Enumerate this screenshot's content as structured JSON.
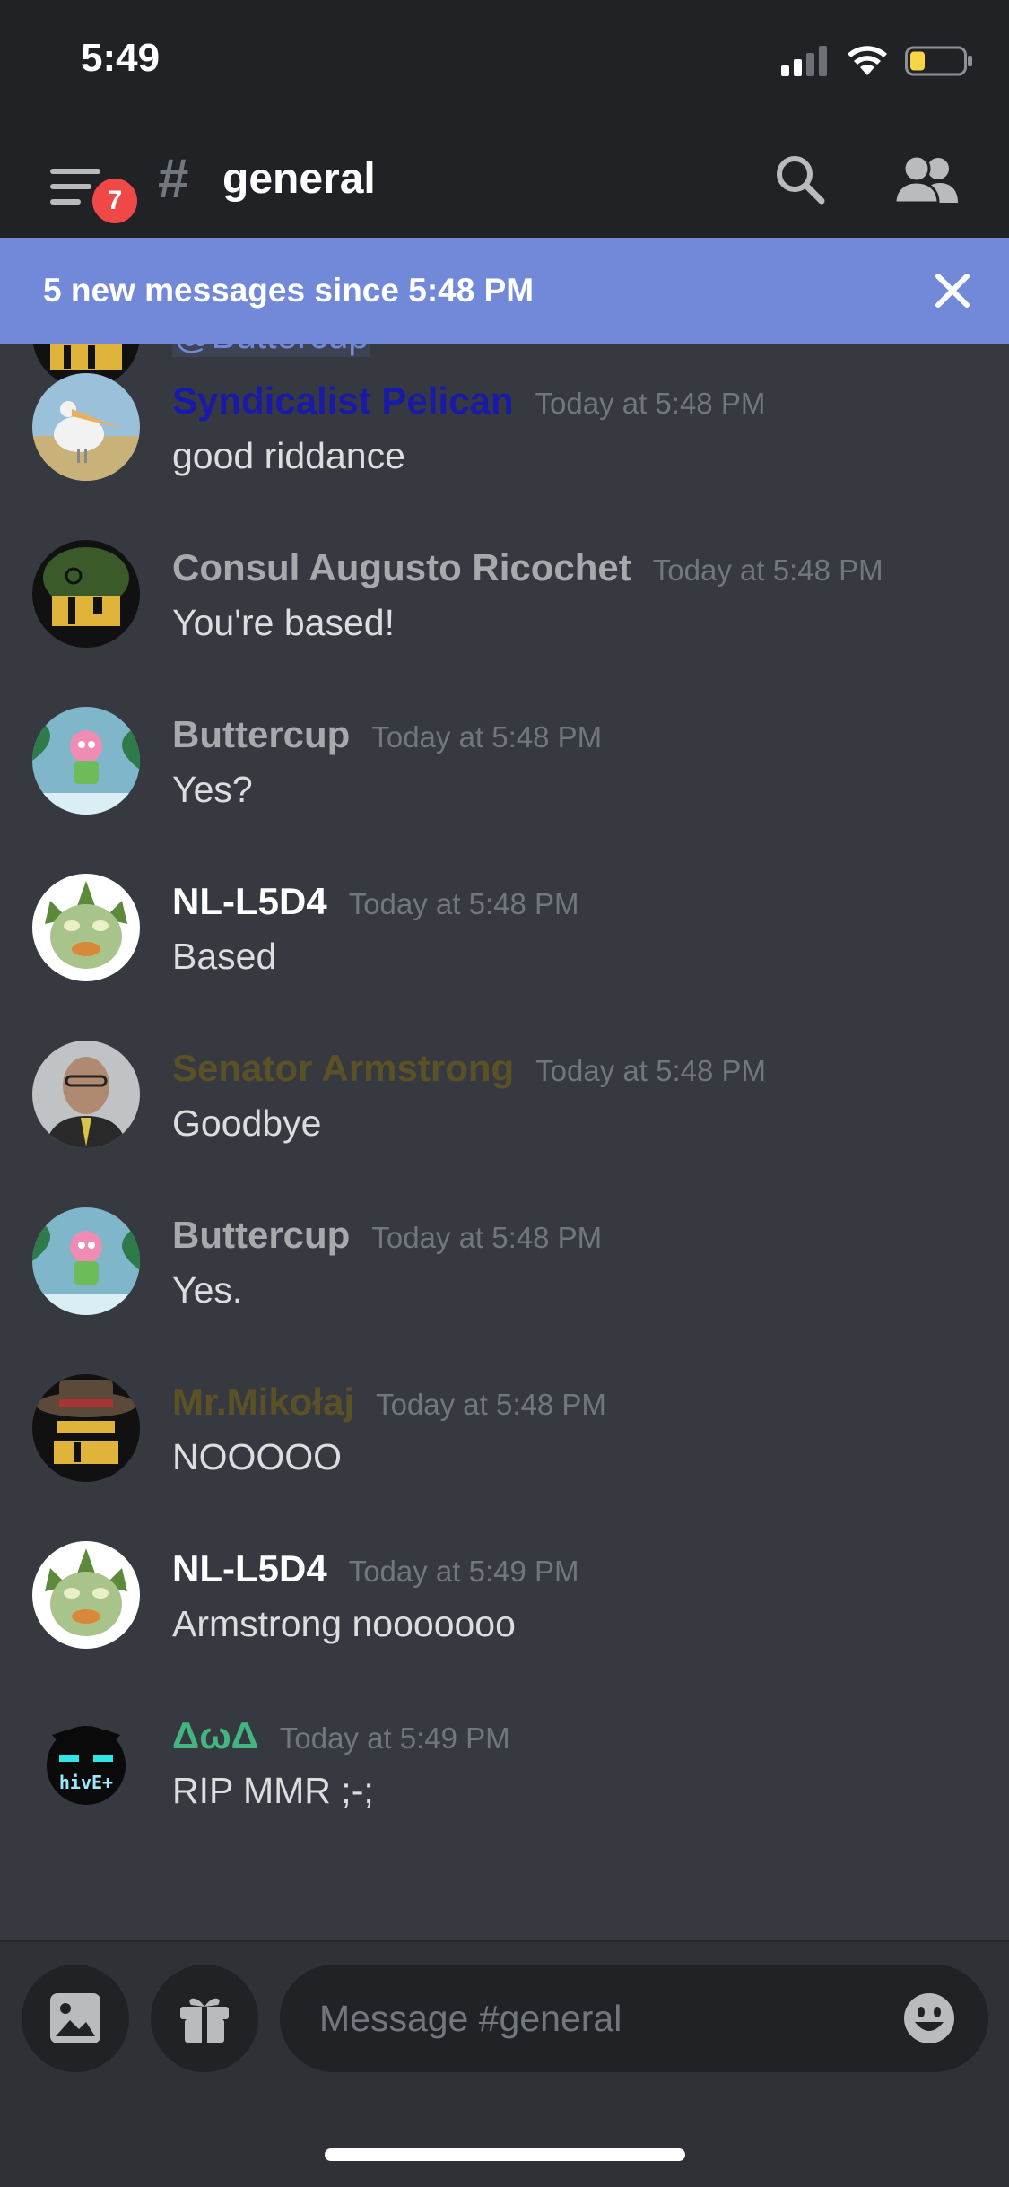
{
  "status_bar": {
    "time": "5:49"
  },
  "header": {
    "unread_badge": "7",
    "hash_symbol": "#",
    "channel_name": "general"
  },
  "banner": {
    "text": "5 new messages since 5:48 PM"
  },
  "partial_message": {
    "content": "@Buttercup"
  },
  "messages": [
    {
      "author": "Syndicalist Pelican",
      "author_color": "#1a1aa8",
      "timestamp": "Today at 5:48 PM",
      "content": "good riddance",
      "avatar": "pelican-avatar"
    },
    {
      "author": "Consul Augusto Ricochet",
      "author_color": "#a7a9ac",
      "timestamp": "Today at 5:48 PM",
      "content": "You're based!",
      "avatar": "helmet-cat-avatar"
    },
    {
      "author": "Buttercup",
      "author_color": "#a7a9ac",
      "timestamp": "Today at 5:48 PM",
      "content": "Yes?",
      "avatar": "pink-hedgehog-avatar"
    },
    {
      "author": "NL-L5D4",
      "author_color": "#ffffff",
      "timestamp": "Today at 5:48 PM",
      "content": "Based",
      "avatar": "green-creature-avatar"
    },
    {
      "author": "Senator Armstrong",
      "author_color": "#5b5126",
      "timestamp": "Today at 5:48 PM",
      "content": "Goodbye",
      "avatar": "senator-avatar"
    },
    {
      "author": "Buttercup",
      "author_color": "#a7a9ac",
      "timestamp": "Today at 5:48 PM",
      "content": "Yes.",
      "avatar": "pink-hedgehog-avatar"
    },
    {
      "author": "Mr.Mikołaj",
      "author_color": "#5b5126",
      "timestamp": "Today at 5:48 PM",
      "content": "NOOOOO",
      "avatar": "hat-cat-avatar"
    },
    {
      "author": "NL-L5D4",
      "author_color": "#ffffff",
      "timestamp": "Today at 5:49 PM",
      "content": "Armstrong nooooooo",
      "avatar": "green-creature-avatar"
    },
    {
      "author": "ΔωΔ",
      "author_color": "#43b581",
      "timestamp": "Today at 5:49 PM",
      "content": "RIP MMR ;-;",
      "avatar": "pixel-cat-avatar"
    }
  ],
  "hive_text": "hivE+",
  "composer": {
    "placeholder": "Message #general"
  },
  "colors": {
    "background": "#36393f",
    "header": "#202225",
    "banner": "#7289da",
    "badge": "#f04747"
  }
}
